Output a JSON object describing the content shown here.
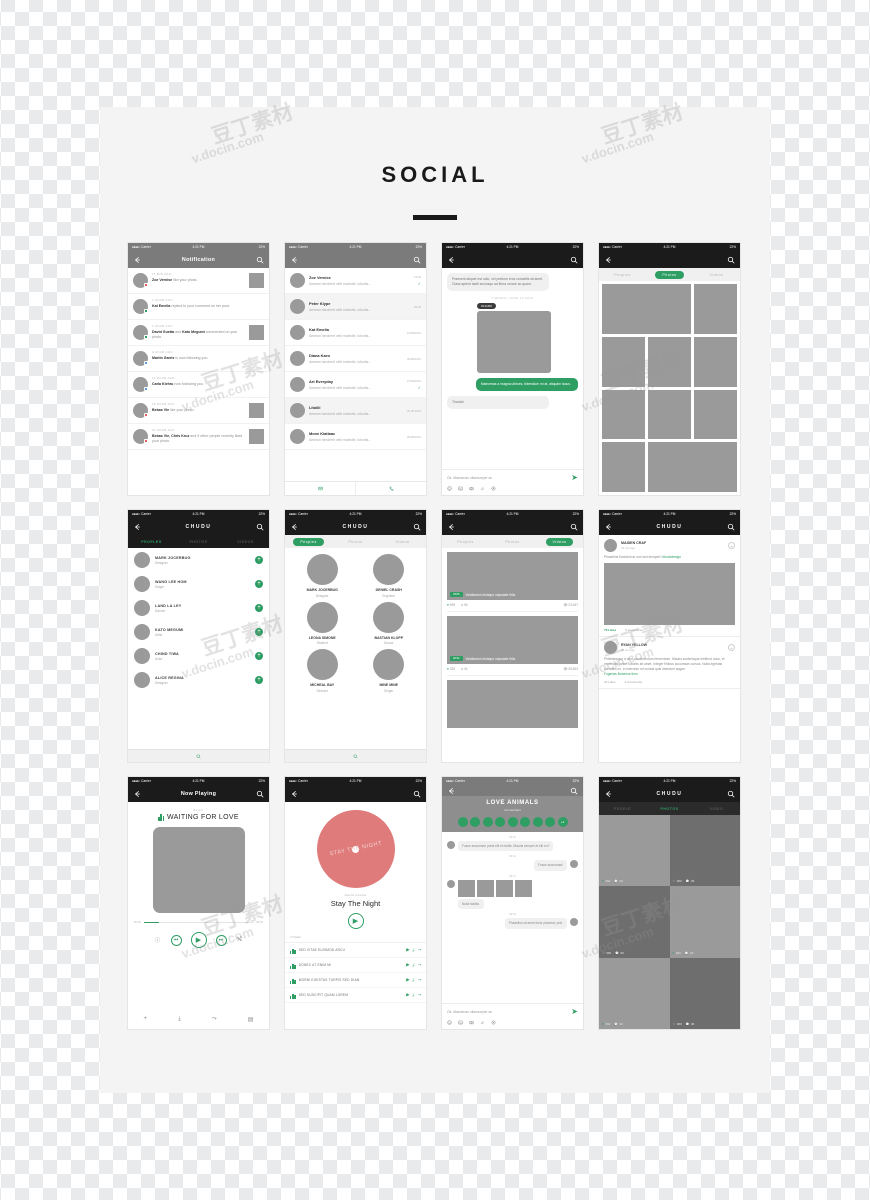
{
  "page": {
    "title": "SOCIAL"
  },
  "status_bar": {
    "carrier": "Carrier",
    "time": "4:21 PM",
    "battery": "22%",
    "dots": "●●●●○"
  },
  "screens": [
    {
      "id": "notification",
      "nav_title": "Notification",
      "items": [
        {
          "ago": "15 MIN AGO",
          "who": "Zoe Vernise",
          "text": "like your photo.",
          "thumb": true,
          "badge": "#e05a5a"
        },
        {
          "ago": "1 HOUR AGO",
          "who": "Kat Emelia",
          "text": "replied to your comment on her post.",
          "thumb": false,
          "badge": "#2e9e63"
        },
        {
          "ago": "1 HOUR AGO",
          "who": "David Guetta",
          "who2": "Kato Megumi",
          "join": "and",
          "text": "commented on your photo.",
          "thumb": true,
          "badge": "#2e9e63"
        },
        {
          "ago": "9 HOUR AGO",
          "who": "Martin Garrix",
          "text": "is now following you.",
          "thumb": false,
          "badge": "#5aa0e0"
        },
        {
          "ago": "13 HOUR AGO",
          "who": "Carla Kiehru",
          "text": "now following you.",
          "thumb": false,
          "badge": "#5aa0e0"
        },
        {
          "ago": "18 HOUR AGO",
          "who": "Bebas Vie",
          "text": "like your photo.",
          "thumb": true,
          "badge": "#e05a5a"
        },
        {
          "ago": "23 HOUR AGO",
          "who": "Bebas Vie, Chris Kruz",
          "join": "and",
          "text": "9 other people recently liked your photo.",
          "thumb": true,
          "badge": "#e05a5a"
        }
      ]
    },
    {
      "id": "chat-list",
      "nav_title": "",
      "preview": "Aenean hendrerit velit molestie, lobortis...",
      "rows": [
        {
          "name": "Zoe Vernice",
          "time": "13:45",
          "tick": true
        },
        {
          "name": "Peter Klype",
          "time": "09:30",
          "tick": false
        },
        {
          "name": "Kat Emelia",
          "time": "10/08/2016",
          "tick": false
        },
        {
          "name": "Diana Kaes",
          "time": "30/08/2016",
          "tick": false
        },
        {
          "name": "Art Everyday",
          "time": "27/08/2016",
          "tick": true
        },
        {
          "name": "Litollil",
          "time": "26 05 2016",
          "tick": false
        },
        {
          "name": "Mone Klatlaac",
          "time": "20/08/2016",
          "tick": false
        }
      ],
      "bottom": [
        "message-icon",
        "phone-icon"
      ]
    },
    {
      "id": "conversation",
      "messages": [
        {
          "side": "in",
          "text": "Praesent aliquet est odio, vel pretium eros convallis sit amet. Class aptent taciti sociosqu ad litora  ornare ac quam."
        },
        {
          "day": "TUESDAY JUNE 19 2016"
        },
        {
          "chip": "03:21PM"
        },
        {
          "side": "image"
        },
        {
          "side": "out",
          "text": "Maecenas a magna ultrices, bibendum mi at, aliquam lacus."
        },
        {
          "side": "in",
          "text": "Thanks!"
        }
      ],
      "input": {
        "value": "Ok. Maecenas ullamcorper se",
        "placeholder": "Type a message"
      }
    },
    {
      "id": "photos-grid",
      "tabs": [
        "Peoples",
        "Photos",
        "Videos"
      ],
      "active_tab": "Photos"
    },
    {
      "id": "people-list",
      "nav_title": "CHUDU",
      "tabs": [
        "PEOPLES",
        "PHOTOS",
        "VIDEOS"
      ],
      "active_tab": "PEOPLES",
      "people": [
        {
          "name": "MARK JOCERBUG",
          "job": "Designer"
        },
        {
          "name": "WANG LEE HOM",
          "job": "Singer"
        },
        {
          "name": "LAND LA LEY",
          "job": "Dancer"
        },
        {
          "name": "KATO MEGUMI",
          "job": "Artist"
        },
        {
          "name": "CHIND TIWA",
          "job": "Actor"
        },
        {
          "name": "ALICE REGINA",
          "job": "Designer"
        }
      ]
    },
    {
      "id": "people-cards",
      "nav_title": "CHUDU",
      "tabs": [
        "Peoples",
        "Photos",
        "Videos"
      ],
      "active_tab": "Peoples",
      "cards": [
        {
          "name": "MARK JOCERBUG",
          "job": "Designer"
        },
        {
          "name": "DENIEL CRASH",
          "job": "Engineer"
        },
        {
          "name": "LEONA SIMONE",
          "job": "Student"
        },
        {
          "name": "BASTIAN KLOPP",
          "job": "Doctor"
        },
        {
          "name": "MICHEAL BAY",
          "job": "Director"
        },
        {
          "name": "MINE MINE",
          "job": "Singer"
        }
      ]
    },
    {
      "id": "videos",
      "tabs": [
        "Peoples",
        "Photos",
        "Videos"
      ],
      "active_tab": "Videos",
      "videos": [
        {
          "duration": "05:05",
          "caption": "Vestibulum tristique vulputate felis.",
          "likes": "699",
          "comments": "65",
          "views": "23,487"
        },
        {
          "duration": "00:52",
          "caption": "Vestibulum tristique vulputate felis.",
          "likes": "353",
          "comments": "34",
          "views": "35,653"
        }
      ]
    },
    {
      "id": "feed",
      "nav_title": "CHUDU",
      "posts": [
        {
          "user": "MAIDEN CRAF",
          "time": "23 min ago",
          "text": "Phasellus tincidunt at orci sed semper!!",
          "tag": "#bookdesign",
          "image": true,
          "likes": "76 Likes",
          "comments": "5 Comments"
        },
        {
          "user": "RYAN YELLOW",
          "time": "35 min ago",
          "text": "Pellentesque a ized condimentum fermentum. Mauris scelerisque eleifend nunc, et venenatis lorem lobortis sit amet. Integer finibus accumsan cursus. Nulla egestas convallis ex, in interdum mi consat quis interdum augue.",
          "tag": "Fugerias finisimus then",
          "image": false,
          "likes": "24 Likes",
          "comments": "4 Comments"
        }
      ]
    },
    {
      "id": "now-playing",
      "nav_title": "Now Playing",
      "artist": "Avicii",
      "song": "WAITING FOR LOVE",
      "elapsed": "00:20",
      "total": "03:45",
      "controls": [
        "info-icon",
        "previous-icon",
        "play-icon",
        "next-icon",
        "shuffle-icon"
      ],
      "bottom": [
        "add-icon",
        "download-icon",
        "share-icon",
        "playlist-icon"
      ]
    },
    {
      "id": "vinyl-player",
      "vinyl_label": "STAY THE NIGHT",
      "artist": "David Guetta",
      "song": "Stay The Night",
      "tracks_header": "4 Tracks",
      "tracks": [
        "SED VITAE EUISMOD ARCU",
        "DONEC AT ENIM MI",
        "MORBI EGESTAS TURPIS SED DIAM",
        "SED SUSCIPIT QUAM LOREM"
      ],
      "vinyl_color": "#e07b7b"
    },
    {
      "id": "group-chat",
      "group_title": "LOVE ANIMALS",
      "group_sub": "12 members",
      "member_count": 8,
      "more_badge": "+4",
      "messages": [
        {
          "time": "09:42",
          "side": "in",
          "text": "Fusce accumsan porta elit et mollis. Mauris semper et elit eu?"
        },
        {
          "time": "09:44",
          "side": "me",
          "text": "Fusce accumsan!"
        },
        {
          "time": "09:47",
          "side": "in",
          "images": 4,
          "text": "Nulla facilisi."
        },
        {
          "time": "09:53",
          "side": "me",
          "text": "Phasellus sit amet dolor placerat, pret."
        }
      ],
      "input": {
        "value": "Ok. Maecenas ullamcorper se",
        "placeholder": "Type a message"
      }
    },
    {
      "id": "dark-photos",
      "nav_title": "CHUDU",
      "tabs": [
        "PEOPLE",
        "PHOTOS",
        "VIDEO"
      ],
      "active_tab": "PHOTOS",
      "cells": [
        {
          "likes": "960",
          "comments": "96",
          "liked": true,
          "shade": "#9a9a9a"
        },
        {
          "likes": "960",
          "comments": "96",
          "liked": false,
          "shade": "#6e6e6e"
        },
        {
          "likes": "960",
          "comments": "96",
          "liked": false,
          "shade": "#6e6e6e"
        },
        {
          "likes": "960",
          "comments": "96",
          "liked": true,
          "shade": "#9a9a9a"
        },
        {
          "likes": "960",
          "comments": "96",
          "liked": true,
          "shade": "#9a9a9a"
        },
        {
          "likes": "960",
          "comments": "96",
          "liked": false,
          "shade": "#6e6e6e"
        }
      ]
    }
  ],
  "theme": {
    "accent": "#2e9e63",
    "dark": "#1b1b1b",
    "gray_nav": "#7b7b7b",
    "placeholder": "#9a9a9a"
  },
  "watermarks": [
    "豆丁素材",
    "v.docin.com"
  ]
}
